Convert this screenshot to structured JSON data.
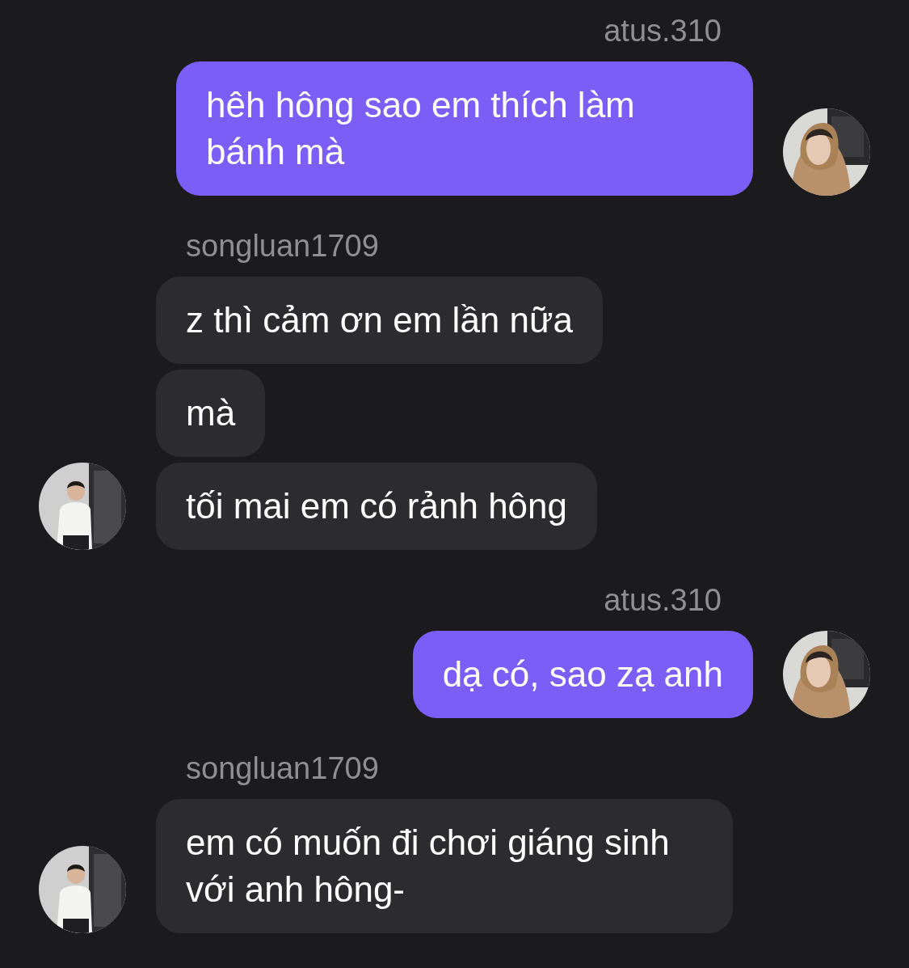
{
  "conversation": [
    {
      "kind": "sent",
      "sender": "atus.310",
      "messages": [
        "hêh hông sao em thích làm bánh mà"
      ]
    },
    {
      "kind": "received",
      "sender": "songluan1709",
      "messages": [
        "z thì cảm ơn em lần nữa",
        "mà",
        "tối mai em có rảnh hông"
      ]
    },
    {
      "kind": "sent",
      "sender": "atus.310",
      "messages": [
        "dạ có, sao zạ anh"
      ]
    },
    {
      "kind": "received",
      "sender": "songluan1709",
      "messages": [
        "em có muốn đi chơi giáng sinh với anh hông-"
      ]
    }
  ]
}
